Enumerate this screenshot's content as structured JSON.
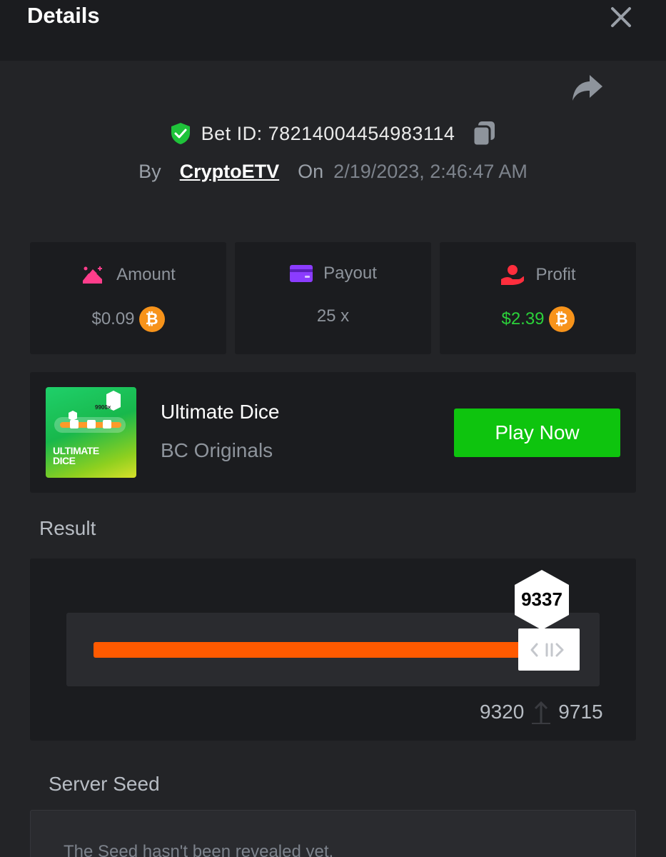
{
  "header": {
    "title": "Details"
  },
  "bet": {
    "id_label": "Bet ID: 78214004454983114",
    "by_label": "By",
    "user": "CryptoETV",
    "on_label": "On",
    "date": "2/19/2023, 2:46:47 AM"
  },
  "stats": {
    "amount": {
      "label": "Amount",
      "value": "$0.09",
      "currency_icon": "bitcoin-icon"
    },
    "payout": {
      "label": "Payout",
      "value": "25 x"
    },
    "profit": {
      "label": "Profit",
      "value": "$2.39",
      "currency_icon": "bitcoin-icon"
    }
  },
  "game": {
    "thumb_title_line1": "ULTIMATE",
    "thumb_title_line2": "DICE",
    "thumb_badge": "9900×",
    "name": "Ultimate Dice",
    "provider": "BC Originals",
    "play_label": "Play Now"
  },
  "result": {
    "label": "Result",
    "roll": "9337",
    "range_low": "9320",
    "range_high": "9715",
    "fill_fraction": 0.9337
  },
  "seed": {
    "label": "Server Seed",
    "message": "The Seed hasn't been revealed yet."
  },
  "colors": {
    "background": "#232427",
    "panel": "#1b1c1f",
    "accent_green": "#0ec40e",
    "profit_green": "#2bd13a",
    "slider_orange": "#ff5a00",
    "bitcoin_orange": "#f7931a",
    "amount_pink": "#ff3d8b",
    "payout_purple": "#8b3cff",
    "profit_red": "#ff2e3d"
  }
}
